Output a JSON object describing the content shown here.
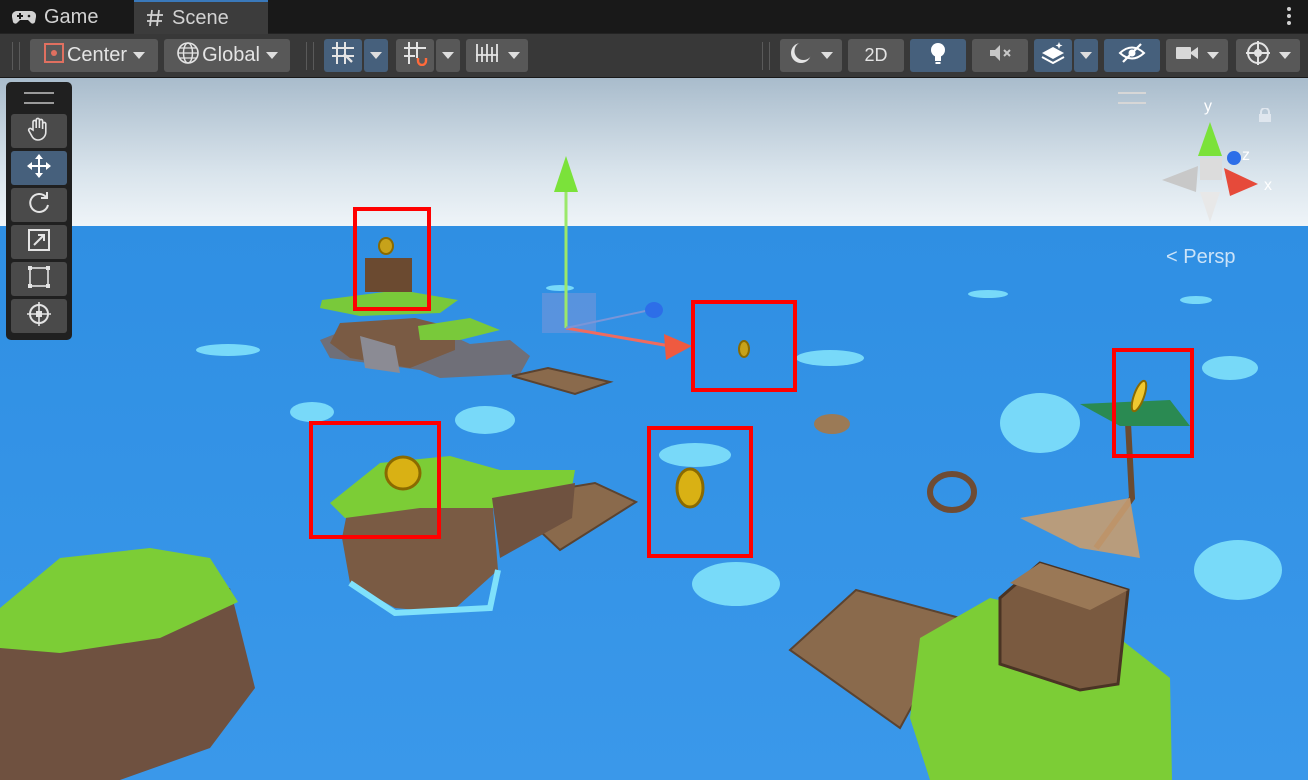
{
  "tabs": [
    {
      "label": "Game",
      "icon": "gamepad-icon",
      "active": false
    },
    {
      "label": "Scene",
      "icon": "hash-icon",
      "active": true
    }
  ],
  "toolbar": {
    "pivot_label": "Center",
    "space_label": "Global",
    "mode_2d_label": "2D"
  },
  "tools": [
    "hand-tool",
    "move-tool",
    "rotate-tool",
    "scale-tool",
    "rect-tool",
    "transform-tool"
  ],
  "active_tool": "move-tool",
  "view": {
    "projection_label": "< Persp",
    "axes": {
      "x": "x",
      "y": "y",
      "z": "z"
    }
  },
  "colors": {
    "accent": "#46607c",
    "highlight": "#ff0000",
    "water": "#3d9be9",
    "grass": "#7ccd36"
  }
}
